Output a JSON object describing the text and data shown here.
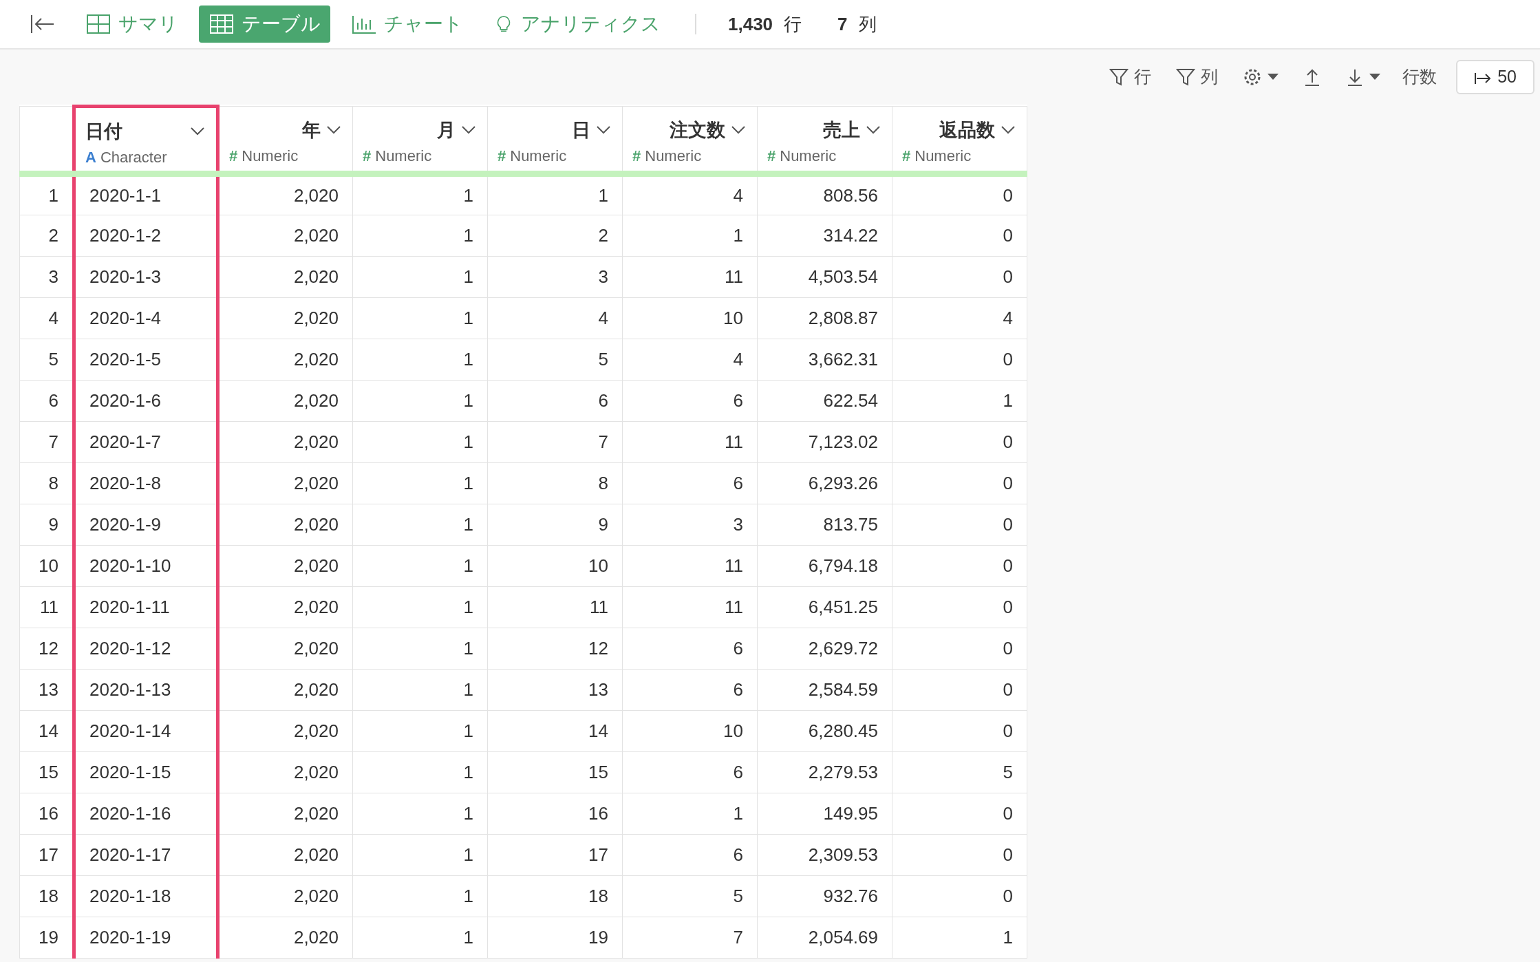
{
  "nav": {
    "tabs": [
      {
        "label": "サマリ",
        "selected": false
      },
      {
        "label": "テーブル",
        "selected": true
      },
      {
        "label": "チャート",
        "selected": false
      },
      {
        "label": "アナリティクス",
        "selected": false
      }
    ],
    "row_count": "1,430",
    "row_unit": "行",
    "col_count": "7",
    "col_unit": "列"
  },
  "toolbar": {
    "filter_rows": "行",
    "filter_cols": "列",
    "rows_label": "行数",
    "rows_value": "50"
  },
  "table": {
    "columns": [
      {
        "name": "日付",
        "type": "Character",
        "type_icon": "A",
        "highlighted": true
      },
      {
        "name": "年",
        "type": "Numeric",
        "type_icon": "#",
        "highlighted": false
      },
      {
        "name": "月",
        "type": "Numeric",
        "type_icon": "#",
        "highlighted": false
      },
      {
        "name": "日",
        "type": "Numeric",
        "type_icon": "#",
        "highlighted": false
      },
      {
        "name": "注文数",
        "type": "Numeric",
        "type_icon": "#",
        "highlighted": false
      },
      {
        "name": "売上",
        "type": "Numeric",
        "type_icon": "#",
        "highlighted": false
      },
      {
        "name": "返品数",
        "type": "Numeric",
        "type_icon": "#",
        "highlighted": false
      }
    ],
    "rows": [
      {
        "row_number": "1",
        "cells": [
          "2020-1-1",
          "2,020",
          "1",
          "1",
          "4",
          "808.56",
          "0"
        ]
      },
      {
        "row_number": "2",
        "cells": [
          "2020-1-2",
          "2,020",
          "1",
          "2",
          "1",
          "314.22",
          "0"
        ]
      },
      {
        "row_number": "3",
        "cells": [
          "2020-1-3",
          "2,020",
          "1",
          "3",
          "11",
          "4,503.54",
          "0"
        ]
      },
      {
        "row_number": "4",
        "cells": [
          "2020-1-4",
          "2,020",
          "1",
          "4",
          "10",
          "2,808.87",
          "4"
        ]
      },
      {
        "row_number": "5",
        "cells": [
          "2020-1-5",
          "2,020",
          "1",
          "5",
          "4",
          "3,662.31",
          "0"
        ]
      },
      {
        "row_number": "6",
        "cells": [
          "2020-1-6",
          "2,020",
          "1",
          "6",
          "6",
          "622.54",
          "1"
        ]
      },
      {
        "row_number": "7",
        "cells": [
          "2020-1-7",
          "2,020",
          "1",
          "7",
          "11",
          "7,123.02",
          "0"
        ]
      },
      {
        "row_number": "8",
        "cells": [
          "2020-1-8",
          "2,020",
          "1",
          "8",
          "6",
          "6,293.26",
          "0"
        ]
      },
      {
        "row_number": "9",
        "cells": [
          "2020-1-9",
          "2,020",
          "1",
          "9",
          "3",
          "813.75",
          "0"
        ]
      },
      {
        "row_number": "10",
        "cells": [
          "2020-1-10",
          "2,020",
          "1",
          "10",
          "11",
          "6,794.18",
          "0"
        ]
      },
      {
        "row_number": "11",
        "cells": [
          "2020-1-11",
          "2,020",
          "1",
          "11",
          "11",
          "6,451.25",
          "0"
        ]
      },
      {
        "row_number": "12",
        "cells": [
          "2020-1-12",
          "2,020",
          "1",
          "12",
          "6",
          "2,629.72",
          "0"
        ]
      },
      {
        "row_number": "13",
        "cells": [
          "2020-1-13",
          "2,020",
          "1",
          "13",
          "6",
          "2,584.59",
          "0"
        ]
      },
      {
        "row_number": "14",
        "cells": [
          "2020-1-14",
          "2,020",
          "1",
          "14",
          "10",
          "6,280.45",
          "0"
        ]
      },
      {
        "row_number": "15",
        "cells": [
          "2020-1-15",
          "2,020",
          "1",
          "15",
          "6",
          "2,279.53",
          "5"
        ]
      },
      {
        "row_number": "16",
        "cells": [
          "2020-1-16",
          "2,020",
          "1",
          "16",
          "1",
          "149.95",
          "0"
        ]
      },
      {
        "row_number": "17",
        "cells": [
          "2020-1-17",
          "2,020",
          "1",
          "17",
          "6",
          "2,309.53",
          "0"
        ]
      },
      {
        "row_number": "18",
        "cells": [
          "2020-1-18",
          "2,020",
          "1",
          "18",
          "5",
          "932.76",
          "0"
        ]
      },
      {
        "row_number": "19",
        "cells": [
          "2020-1-19",
          "2,020",
          "1",
          "19",
          "7",
          "2,054.69",
          "1"
        ]
      }
    ]
  }
}
